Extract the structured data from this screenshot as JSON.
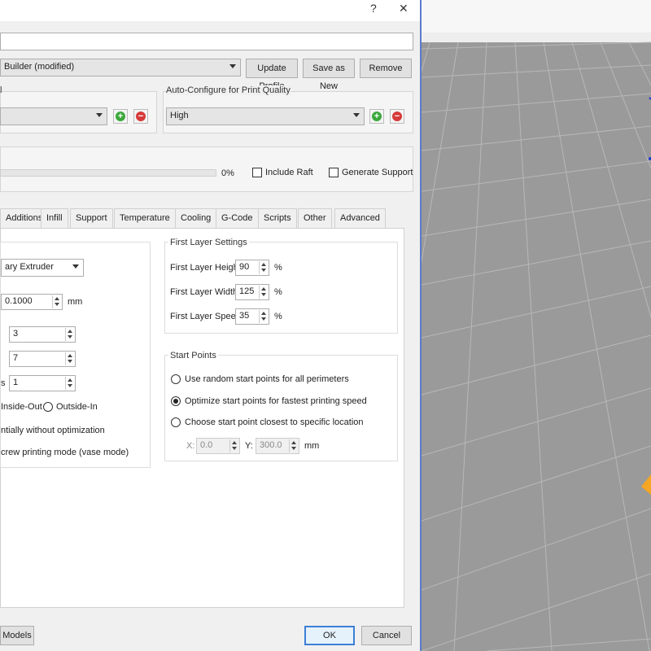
{
  "titlebar": {
    "help_label": "?",
    "close_label": "✕"
  },
  "profile": {
    "name_value": "",
    "selected": "Builder (modified)",
    "update_label": "Update Profile",
    "save_as_new_label": "Save as New",
    "remove_label": "Remove"
  },
  "autoconfig": {
    "left_title": "l",
    "left_selected": "",
    "right_title": "Auto-Configure for Print Quality",
    "right_selected": "High"
  },
  "progress": {
    "value_pct": 0,
    "label": "0%"
  },
  "options": {
    "include_raft": "Include Raft",
    "generate_support": "Generate Support"
  },
  "tabs": [
    {
      "label": "Additions",
      "active": false
    },
    {
      "label": "Infill",
      "active": false
    },
    {
      "label": "Support",
      "active": false
    },
    {
      "label": "Temperature",
      "active": false
    },
    {
      "label": "Cooling",
      "active": false
    },
    {
      "label": "G-Code",
      "active": false
    },
    {
      "label": "Scripts",
      "active": false
    },
    {
      "label": "Other",
      "active": false
    },
    {
      "label": "Advanced",
      "active": false
    }
  ],
  "layer": {
    "extruder": "ary Extruder",
    "layer_height": "0.1000",
    "mm_unit": "mm",
    "top_layers": "3",
    "bottom_layers": "7",
    "perimeter_label": "s",
    "perimeters": "1",
    "inside_out": "Inside-Out",
    "outside_in": "Outside-In",
    "sequential_text": "ntially without optimization",
    "vase_text": "crew printing mode (vase mode)"
  },
  "first_layer": {
    "title": "First Layer Settings",
    "height_label": "First Layer Height",
    "height_value": "90",
    "width_label": "First Layer Width",
    "width_value": "125",
    "speed_label": "First Layer Speed",
    "speed_value": "35",
    "pct": "%"
  },
  "start_points": {
    "title": "Start Points",
    "opt_random": "Use random start points for all perimeters",
    "opt_optimize": "Optimize start points for fastest printing speed",
    "opt_specific": "Choose start point closest to specific location",
    "x_label": "X:",
    "x_value": "0.0",
    "y_label": "Y:",
    "y_value": "300.0",
    "mm_unit": "mm"
  },
  "footer": {
    "models_label": "Models",
    "ok_label": "OK",
    "cancel_label": "Cancel"
  },
  "colors": {
    "accent": "#3c7fd6",
    "viewport_bg": "#9a9a9a",
    "progress": "#06b025",
    "orange": "#f5a623"
  }
}
